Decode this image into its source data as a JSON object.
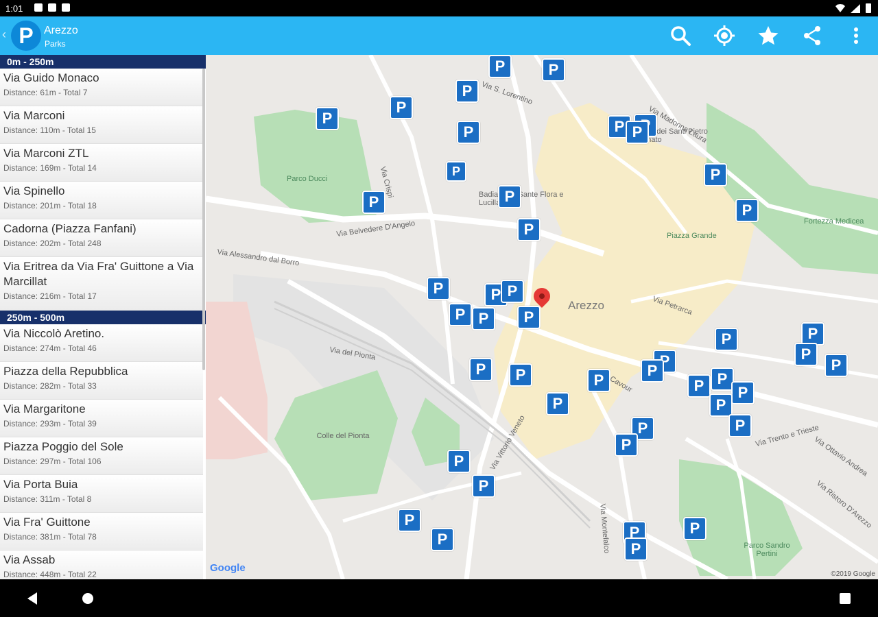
{
  "status": {
    "time": "1:01"
  },
  "appbar": {
    "logo_letter": "P",
    "title": "Arezzo",
    "subtitle": "Parks",
    "actions": [
      "search-icon",
      "my-location-icon",
      "star-icon",
      "share-icon",
      "more-vert-icon"
    ],
    "color": "#2bb6f3"
  },
  "list": {
    "sections": [
      {
        "header": "0m - 250m",
        "items": [
          {
            "name": "Via Guido Monaco",
            "meta": "Distance: 61m - Total 7"
          },
          {
            "name": "Via Marconi",
            "meta": "Distance: 110m - Total 15"
          },
          {
            "name": "Via Marconi ZTL",
            "meta": "Distance: 169m - Total 14"
          },
          {
            "name": "Via Spinello",
            "meta": "Distance: 201m - Total 18"
          },
          {
            "name": "Cadorna (Piazza Fanfani)",
            "meta": "Distance: 202m - Total 248"
          },
          {
            "name": "Via Eritrea da Via Fra' Guittone a Via Marcillat",
            "meta": "Distance: 216m - Total 17"
          }
        ]
      },
      {
        "header": "250m - 500m",
        "items": [
          {
            "name": "Via Niccolò Aretino.",
            "meta": "Distance: 274m - Total 46"
          },
          {
            "name": "Piazza della Repubblica",
            "meta": "Distance: 282m - Total 33"
          },
          {
            "name": "Via Margaritone",
            "meta": "Distance: 293m - Total 39"
          },
          {
            "name": "Piazza Poggio del Sole",
            "meta": "Distance: 297m - Total 106"
          },
          {
            "name": "Via Porta Buia",
            "meta": "Distance: 311m - Total 8"
          },
          {
            "name": "Via Fra' Guittone",
            "meta": "Distance: 381m - Total 78"
          },
          {
            "name": "Via Assab",
            "meta": "Distance: 448m - Total 22"
          }
        ]
      }
    ],
    "section_color": "#17306a"
  },
  "map": {
    "city_label": "Arezzo",
    "labels": {
      "parco_ducci": "Parco Ducci",
      "piazza_grande": "Piazza Grande",
      "fortezza": "Fortezza Medicea",
      "colle_del_pionta": "Colle del Pionta",
      "parco_sandro": "Parco Sandro Pertini",
      "badia": "Badia delle Sante Flora e Lucilla",
      "santi": "Chiesa dei Santi Pietro e Donato",
      "via_belvedere": "Via Belvedere D'Angelo",
      "via_alessandro": "Via Alessandro dal Borro",
      "via_crispi": "Via Crispi",
      "via_madonna": "Via Madonna Laura",
      "via_lorentino": "Via S. Lorentino",
      "via_dei_pionta": "Via del Pionta",
      "via_vittorio": "Via Vittorio Veneto",
      "via_cavour": "Via Cavour",
      "via_petrarca": "Via Petrarca",
      "via_ottavio": "Via Ottavio Andrea",
      "via_montefalco": "Via Montefalco",
      "via_ristoro": "Via Ristoro D'Arezzo",
      "via_trento": "Via Trento e Trieste"
    },
    "parking_symbol": "P",
    "google_text": "Google",
    "copyright": "©2019 Google",
    "park_color": "#1b6ec4"
  }
}
